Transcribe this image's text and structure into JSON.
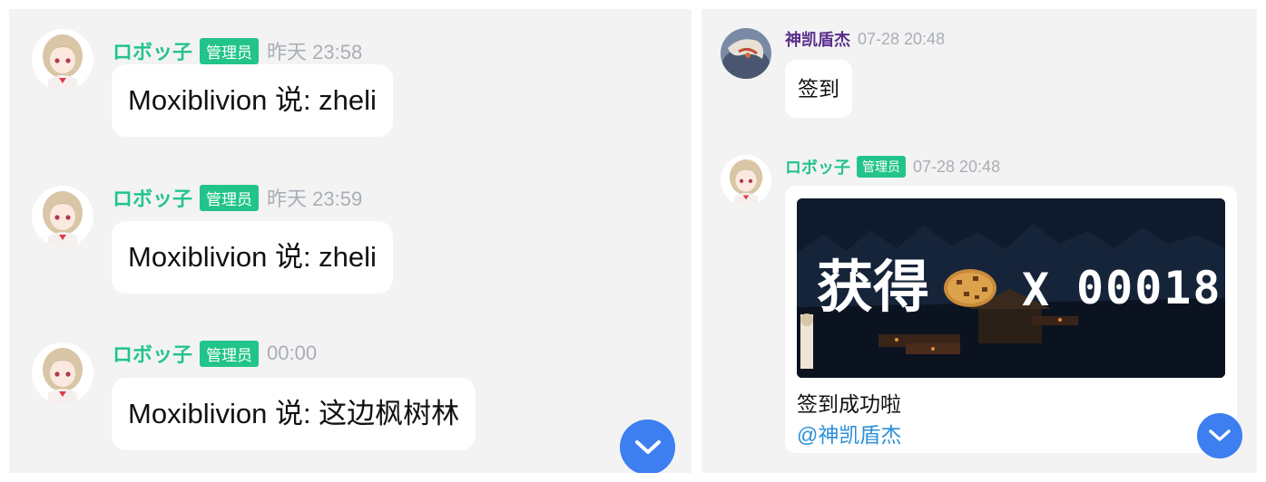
{
  "left_panel": {
    "messages": [
      {
        "sender": "ロボッ子",
        "badge": "管理员",
        "time": "昨天 23:58",
        "text": "Moxiblivion 说: zheli"
      },
      {
        "sender": "ロボッ子",
        "badge": "管理员",
        "time": "昨天 23:59",
        "text": "Moxiblivion 说: zheli"
      },
      {
        "sender": "ロボッ子",
        "badge": "管理员",
        "time": "00:00",
        "text": "Moxiblivion 说: 这边枫树林"
      }
    ]
  },
  "right_panel": {
    "messages": [
      {
        "sender": "神凯盾杰",
        "time": "07-28 20:48",
        "text": "签到"
      },
      {
        "sender": "ロボッ子",
        "badge": "管理员",
        "time": "07-28 20:48",
        "image_text": {
          "label": "获得",
          "multiplier": "X",
          "count": "00018"
        },
        "text": "签到成功啦",
        "mention": "@神凯盾杰"
      }
    ]
  },
  "icons": {
    "scroll_button": "chevron-down-icon",
    "item": "cookie-icon"
  },
  "colors": {
    "panel_bg": "#f3f3f3",
    "admin_name": "#22c48a",
    "badge_bg": "#22c48a",
    "user_name": "#5a2f8c",
    "timestamp": "#a9aeb6",
    "scroll_button": "#3d7ef0",
    "mention": "#2b8fd8"
  }
}
